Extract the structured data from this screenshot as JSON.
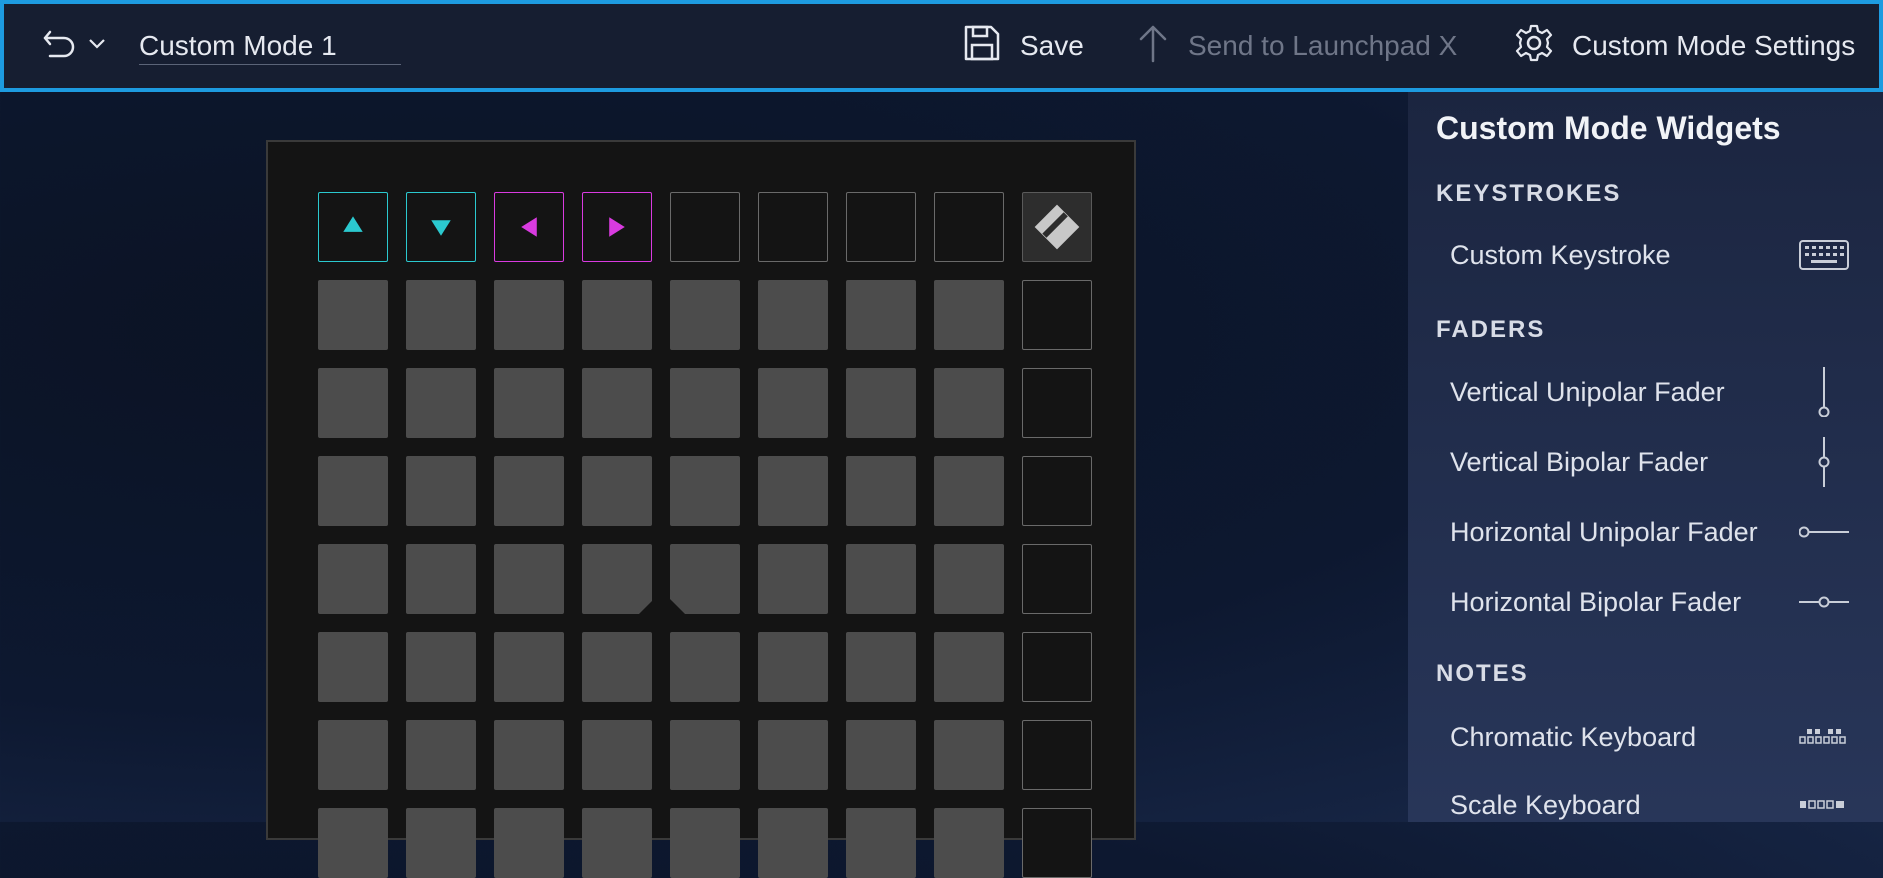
{
  "toolbar": {
    "mode_name": "Custom Mode 1",
    "save_label": "Save",
    "send_label": "Send to Launchpad X",
    "settings_label": "Custom Mode Settings"
  },
  "panel": {
    "title": "Custom Mode Widgets",
    "sections": {
      "keystrokes": {
        "heading": "KEYSTROKES",
        "items": [
          "Custom Keystroke"
        ]
      },
      "faders": {
        "heading": "FADERS",
        "items": [
          "Vertical Unipolar Fader",
          "Vertical Bipolar Fader",
          "Horizontal Unipolar Fader",
          "Horizontal Bipolar Fader"
        ]
      },
      "notes": {
        "heading": "NOTES",
        "items": [
          "Chromatic Keyboard",
          "Scale Keyboard"
        ]
      }
    }
  },
  "colors": {
    "accent": "#1d9be0",
    "arrow_up_down": "#2bc9cf",
    "arrow_left_right": "#d93be0",
    "pad_fill": "#4c4c4c"
  }
}
